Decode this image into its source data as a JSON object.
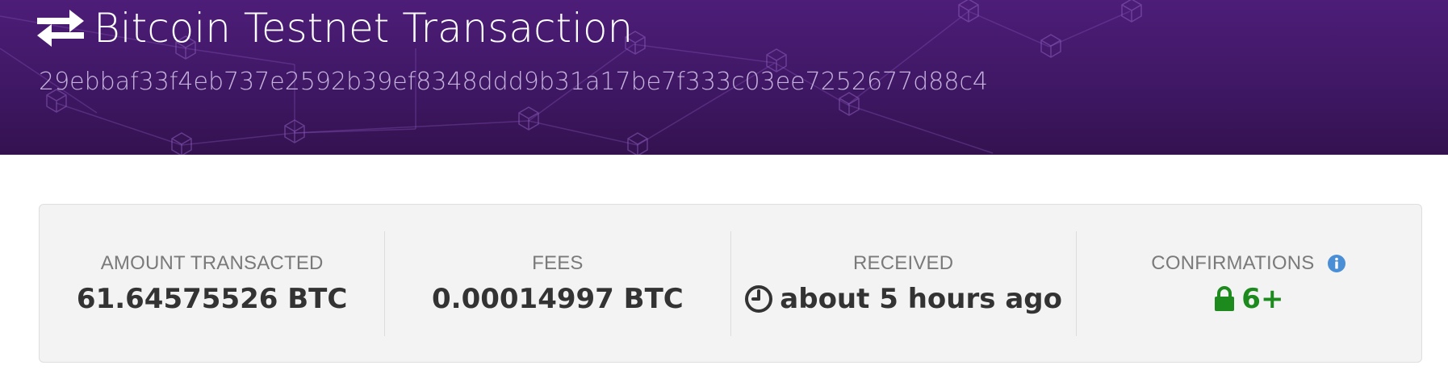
{
  "header": {
    "title": "Bitcoin Testnet Transaction",
    "tx_hash": "29ebbaf33f4eb737e2592b39ef8348ddd9b31a17be7f333c03ee7252677d88c4",
    "title_icon": "exchange-arrows-icon"
  },
  "stats": [
    {
      "label": "AMOUNT TRANSACTED",
      "value": "61.64575526 BTC"
    },
    {
      "label": "FEES",
      "value": "0.00014997 BTC"
    },
    {
      "label": "RECEIVED",
      "value": "about 5 hours ago",
      "icon": "clock-icon"
    },
    {
      "label": "CONFIRMATIONS",
      "value": "6+",
      "icon": "lock-icon",
      "info_icon": "info-icon"
    }
  ],
  "colors": {
    "header_bg": "#4d1d78",
    "confirmations_value": "#1c8a1c",
    "info_icon": "#4a8fd6"
  }
}
